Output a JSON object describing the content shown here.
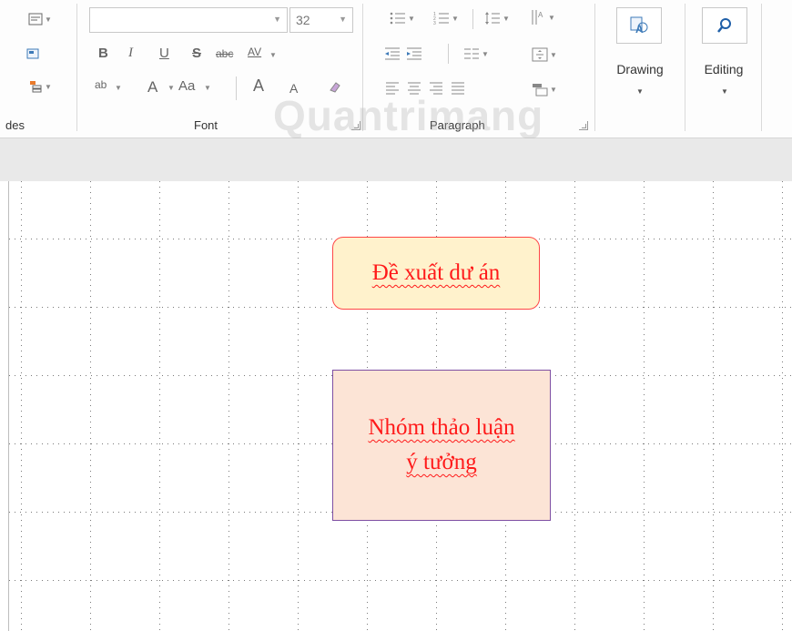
{
  "ribbon": {
    "slides_group_label": "des",
    "font_group_label": "Font",
    "paragraph_group_label": "Paragraph",
    "font_name_value": "",
    "font_size_value": "32",
    "bold_label": "B",
    "italic_label": "I",
    "underline_label": "U",
    "shadow_label": "S",
    "strikethrough_label": "abc",
    "spacing_label": "AV",
    "highlight_label": "ab",
    "font_color_label": "A",
    "change_case_label": "Aa",
    "grow_font_label": "A",
    "shrink_font_label": "A",
    "drawing_label": "Drawing",
    "editing_label": "Editing"
  },
  "watermark": "Quantrimang",
  "slide": {
    "shape1_text": "Đề xuất dư án",
    "shape2_line1": "Nhóm thảo luận",
    "shape2_line2": "ý tưởng"
  },
  "colors": {
    "shape1_fill": "#fff2cc",
    "shape1_border": "#ff4747",
    "shape2_fill": "#fce4d6",
    "shape2_border": "#7e4fa3",
    "text_color": "#ff1a1a"
  }
}
